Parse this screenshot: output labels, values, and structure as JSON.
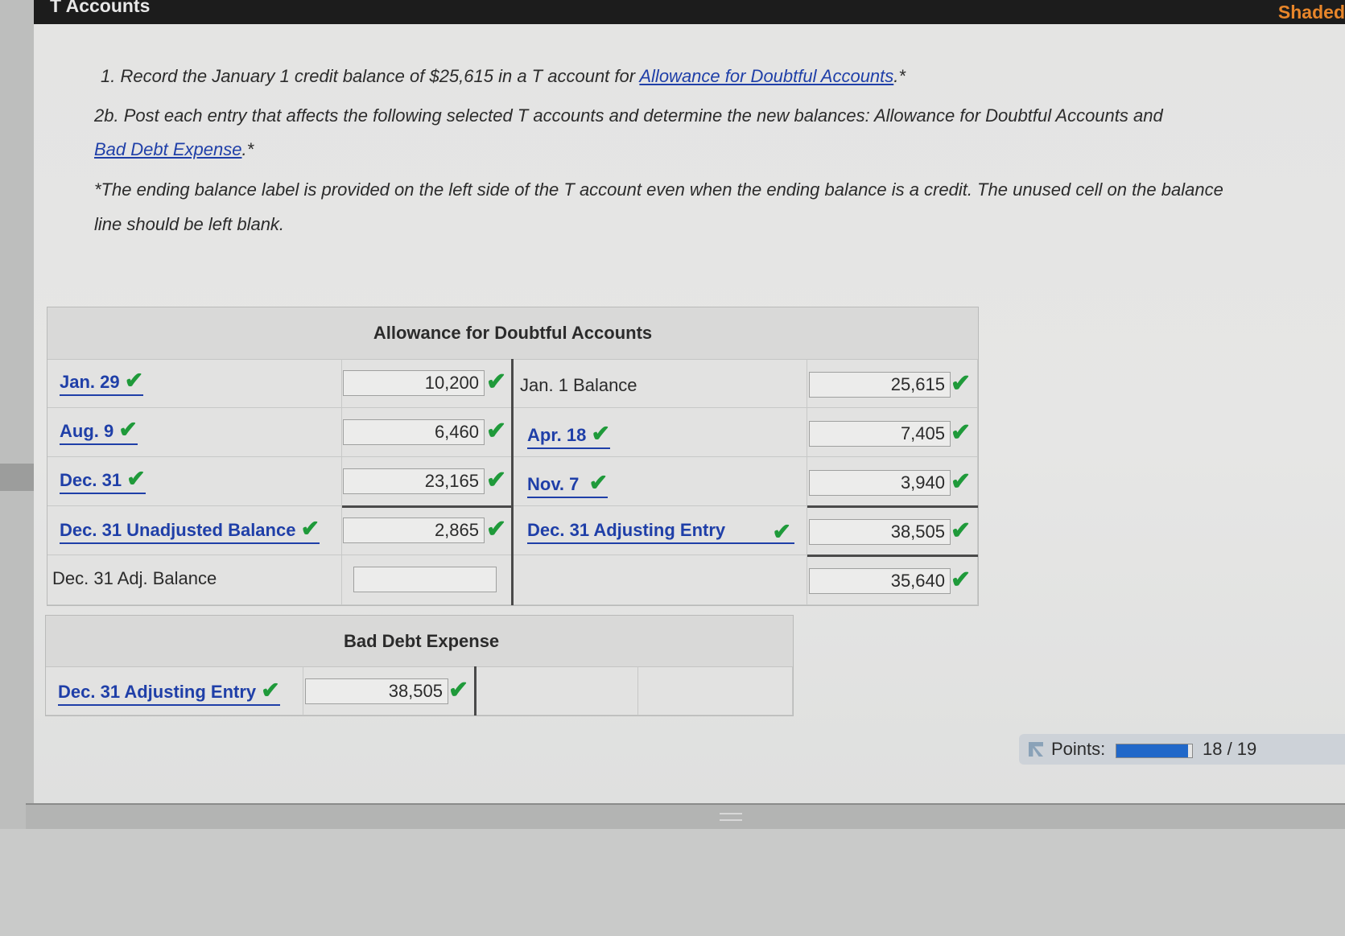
{
  "window": {
    "title": "T Accounts",
    "mode_label": "Shaded"
  },
  "instructions": {
    "line1_prefix": "1. Record the January 1 credit balance of $25,615 in a T account for ",
    "line1_link": "Allowance for Doubtful Accounts",
    "line1_suffix": ".*",
    "line2": "2b. Post each entry that affects the following selected T accounts and determine the new balances: Allowance for Doubtful Accounts and",
    "line3_link": "Bad Debt Expense",
    "line3_suffix": ".*",
    "note1": "*The ending balance label is provided on the left side of the T account even when the ending balance is a credit. The unused cell on the balance",
    "note2": "line should be left blank."
  },
  "allowance": {
    "title": "Allowance for Doubtful Accounts",
    "rows": [
      {
        "left_label": "Jan. 29",
        "left_value": "10,200",
        "right_label": "Jan. 1 Balance",
        "right_value": "25,615"
      },
      {
        "left_label": "Aug. 9",
        "left_value": "6,460",
        "right_label": "Apr. 18",
        "right_value": "7,405"
      },
      {
        "left_label": "Dec. 31",
        "left_value": "23,165",
        "right_label": "Nov. 7",
        "right_value": "3,940"
      },
      {
        "left_label": "Dec. 31 Unadjusted Balance",
        "left_value": "2,865",
        "right_label": "Dec. 31 Adjusting Entry",
        "right_value": "38,505"
      },
      {
        "left_label": "Dec. 31 Adj. Balance",
        "left_value": "",
        "right_label": "",
        "right_value": "35,640"
      }
    ]
  },
  "bad_debt": {
    "title": "Bad Debt Expense",
    "rows": [
      {
        "left_label": "Dec. 31 Adjusting Entry",
        "left_value": "38,505"
      }
    ]
  },
  "points": {
    "label": "Points:",
    "value": "18 / 19",
    "fraction": 0.947
  },
  "colors": {
    "link": "#1f3fa8",
    "check": "#1f9a3a",
    "accent": "#e8862a",
    "progress": "#2168c9"
  },
  "icons": {
    "check": "checkmark-icon",
    "flag": "flag-icon",
    "grip": "grip-icon"
  }
}
